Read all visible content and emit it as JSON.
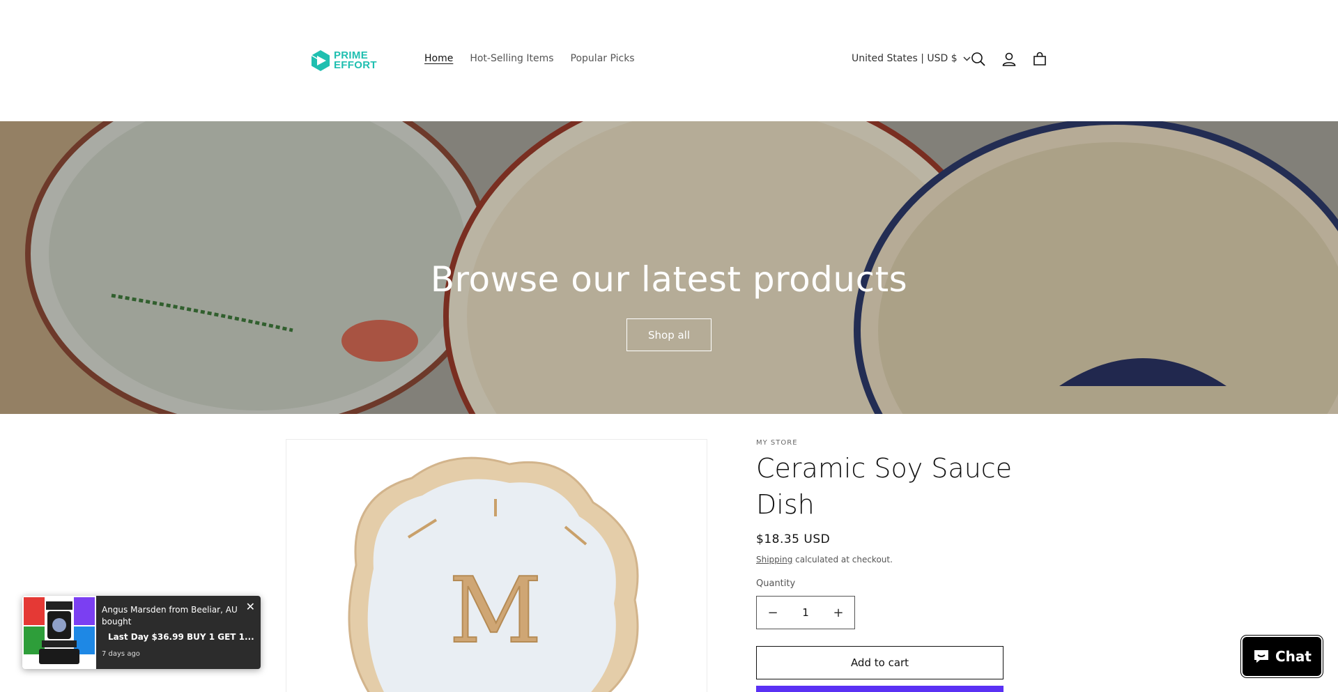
{
  "header": {
    "logo_line1": "PRIME",
    "logo_line2": "EFFORT",
    "nav": [
      {
        "label": "Home"
      },
      {
        "label": "Hot-Selling Items"
      },
      {
        "label": "Popular Picks"
      }
    ],
    "locale": "United States | USD $",
    "icons": {
      "search": "search-icon",
      "account": "account-icon",
      "cart": "cart-icon",
      "chevron": "chevron-down-icon"
    }
  },
  "banner": {
    "title": "Browse our latest products",
    "button": "Shop all"
  },
  "product": {
    "vendor": "MY STORE",
    "title": "Ceramic Soy Sauce Dish",
    "price": "$18.35 USD",
    "shipping_link": "Shipping",
    "shipping_note": " calculated at checkout.",
    "quantity_label": "Quantity",
    "quantity_value": "1",
    "minus": "−",
    "plus": "+",
    "add_to_cart": "Add to cart",
    "buy_color": "#5a31f4",
    "image_letter": "M"
  },
  "popup": {
    "text": "Angus Marsden from Beeliar, AU bought",
    "offer": "Last Day $36.99   BUY 1 GET 1...",
    "time": "7 days ago",
    "close": "✕"
  },
  "chat": {
    "label": "Chat"
  },
  "colors": {
    "logo": "#1fbfb0",
    "buy_now": "#5a31f4"
  }
}
